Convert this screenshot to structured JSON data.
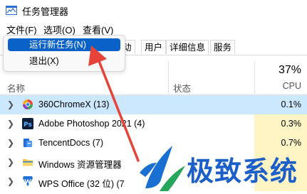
{
  "window": {
    "title": "任务管理器"
  },
  "menu": {
    "file": "文件(F)",
    "options": "选项(O)",
    "view": "查看(V)"
  },
  "file_menu": {
    "items": [
      "运行新任务(N)",
      "退出(X)"
    ],
    "highlighted": "运行新任务(N)"
  },
  "tabs": [
    "动",
    "用户",
    "详细信息",
    "服务"
  ],
  "table": {
    "cpu_total": "37%",
    "columns": {
      "name": "名称",
      "status": "状态",
      "cpu": "CPU"
    },
    "rows": [
      {
        "name": "360ChromeX (13)",
        "cpu": "0.1%",
        "icon": "360chrome-icon"
      },
      {
        "name": "Adobe Photoshop 2021 (4)",
        "cpu": "0.3%",
        "icon": "photoshop-icon"
      },
      {
        "name": "TencentDocs (7)",
        "cpu": "0.7%",
        "icon": "tencentdocs-icon"
      },
      {
        "name": "Windows 资源管理器",
        "cpu": "",
        "icon": "folder-icon"
      },
      {
        "name": "WPS Office (32 位) (7",
        "cpu": "",
        "icon": "wps-icon"
      }
    ]
  },
  "watermark": {
    "text": "极致系统"
  },
  "colors": {
    "selection": "#cce8ff",
    "menu_highlight": "#0a62c9",
    "cpu_cell": "#fff4c4",
    "arrow": "#e8433a",
    "watermark": "#1d5fc8"
  }
}
